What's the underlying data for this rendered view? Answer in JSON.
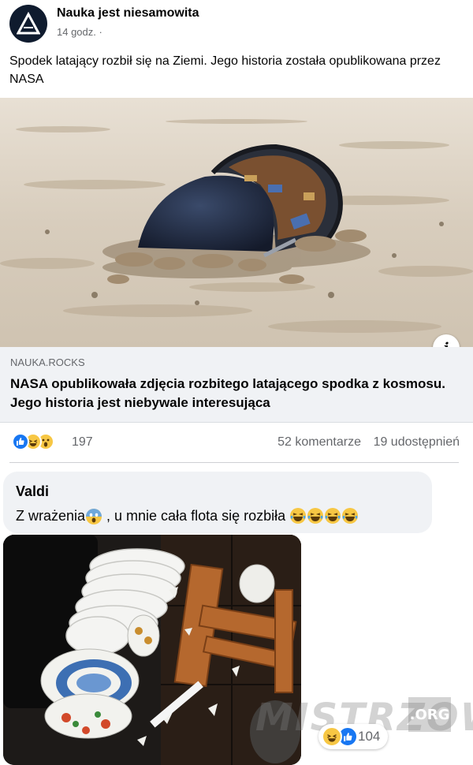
{
  "post": {
    "page_name": "Nauka jest niesamowita",
    "time": "14 godz.",
    "visibility_separator": "·",
    "text": "Spodek latający rozbił się na Ziemi. Jego historia została opublikowana przez NASA"
  },
  "link_card": {
    "image_alt": "Rozbity spodek latający wbity w piasek pustyni",
    "domain": "NAUKA.ROCKS",
    "title": "NASA opublikowała zdjęcia rozbitego latającego spodka z kosmosu. Jego historia jest niebywale interesująca",
    "info_icon": "i"
  },
  "stats": {
    "reaction_icons": [
      "like-icon",
      "laugh-icon",
      "wow-icon"
    ],
    "reaction_count": "197",
    "comments": "52 komentarze",
    "shares": "19 udostępnień"
  },
  "comment": {
    "author": "Valdi",
    "text_part1": "Z wrażenia",
    "text_part2": " , u mnie cała flota się rozbiła ",
    "image_alt": "Stos rozbitych talerzy na podłodze obok przewróconego krzesła",
    "reaction_icons": [
      "laugh-icon",
      "like-icon"
    ],
    "reaction_count": "104"
  },
  "watermark": {
    "text": "MISTRZOWIE",
    "suffix": ".ORG"
  },
  "colors": {
    "like_blue": "#1877f2",
    "emoji_yellow": "#f7c744",
    "secondary_text": "#65676b",
    "card_bg": "#f0f2f5"
  }
}
